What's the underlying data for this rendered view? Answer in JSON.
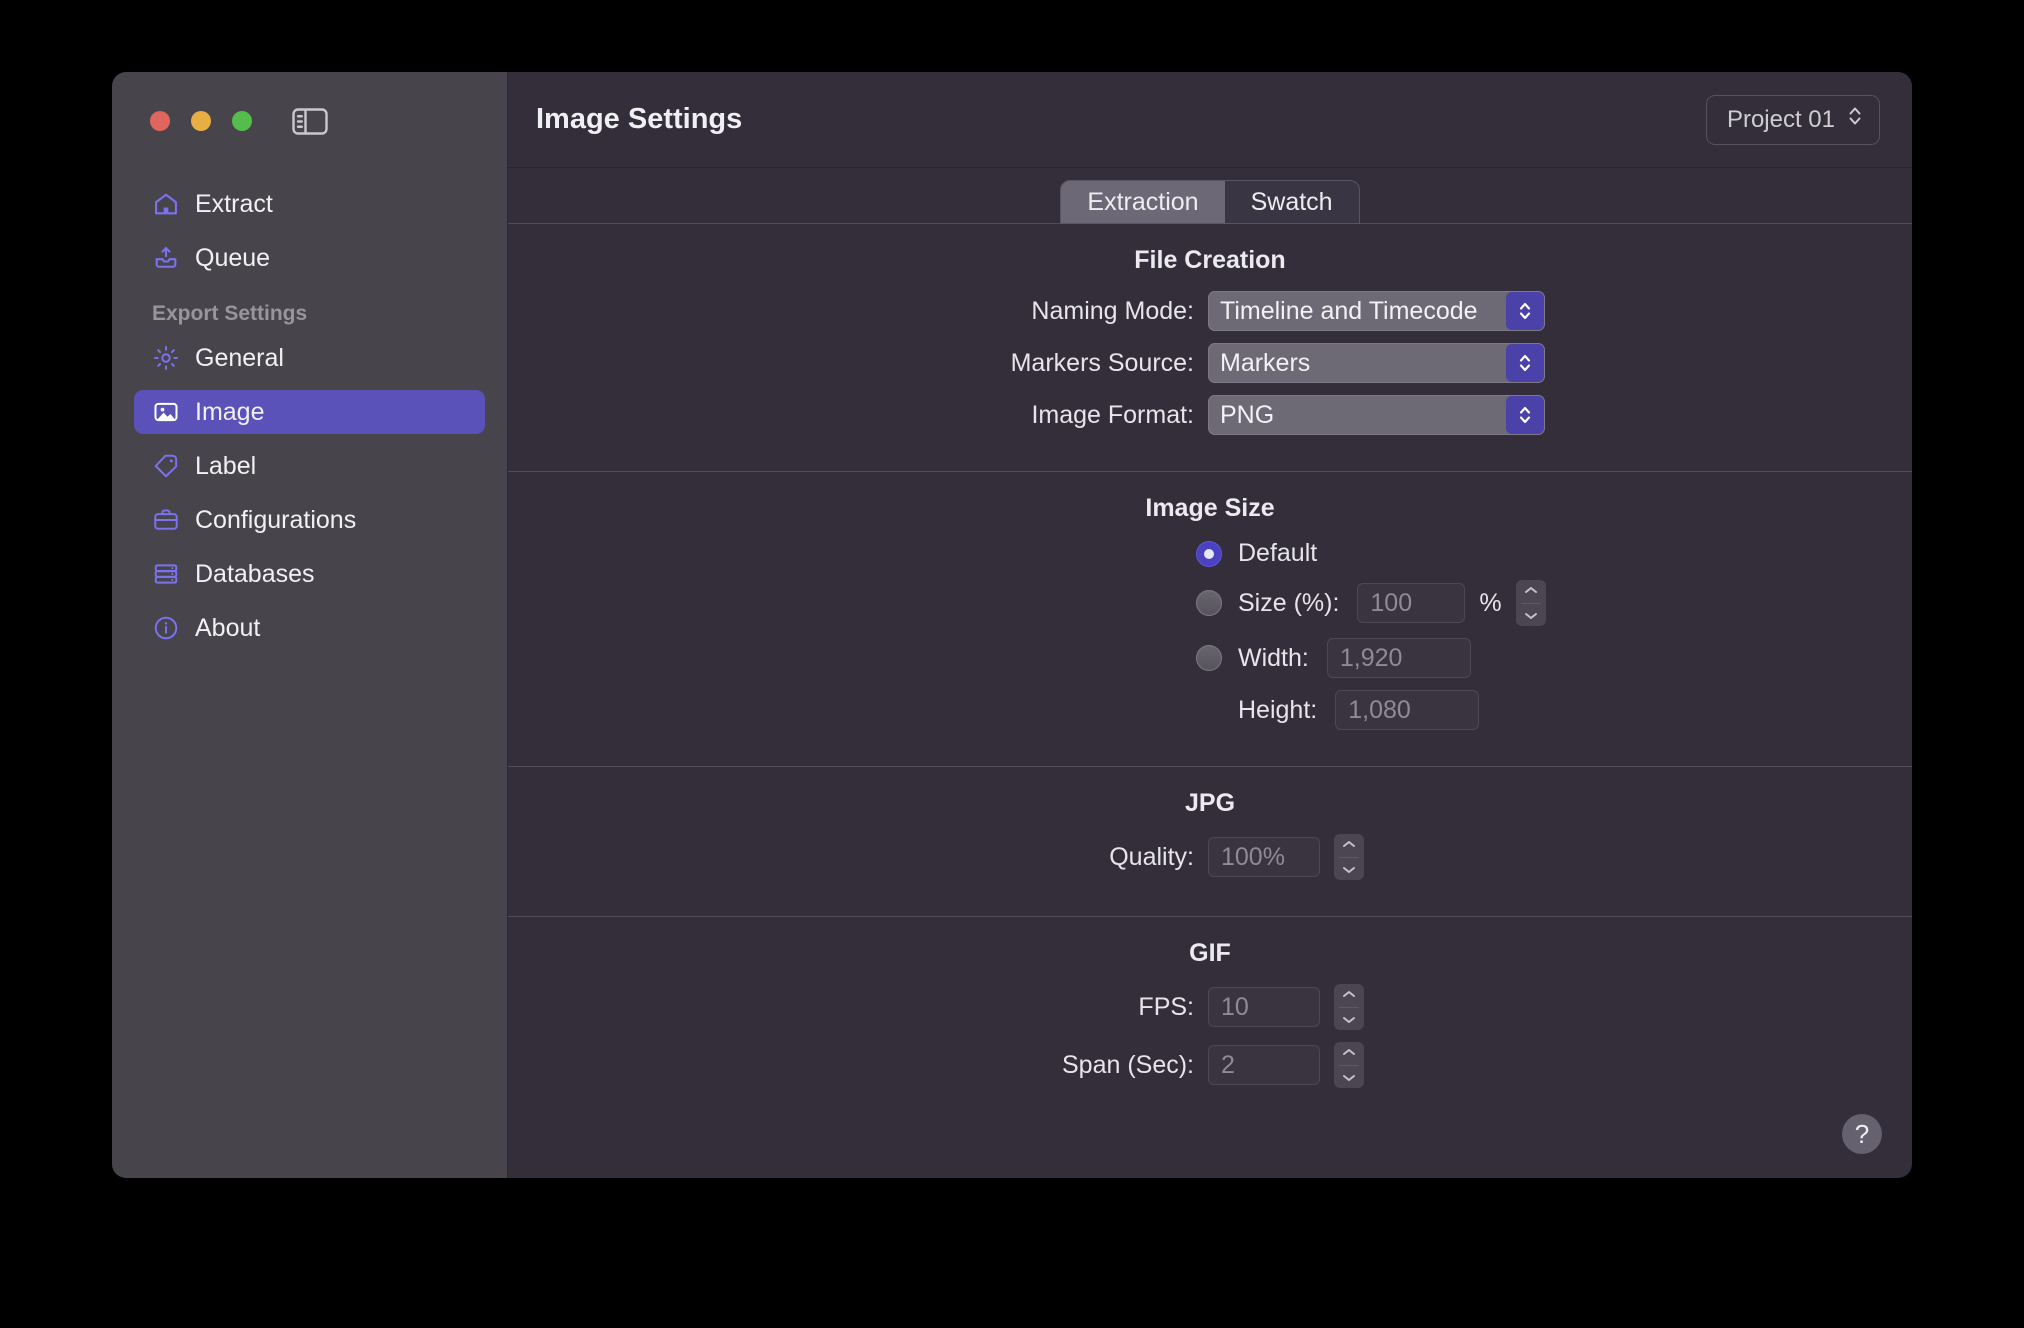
{
  "window": {
    "traffic_lights": [
      "close",
      "minimize",
      "zoom"
    ],
    "sidebar_toggle_icon": "sidebar-toggle-icon"
  },
  "sidebar": {
    "top_items": [
      {
        "label": "Extract",
        "icon": "house-icon"
      },
      {
        "label": "Queue",
        "icon": "tray-upload-icon"
      }
    ],
    "group_label": "Export Settings",
    "settings_items": [
      {
        "label": "General",
        "icon": "gear-icon"
      },
      {
        "label": "Image",
        "icon": "photo-icon"
      },
      {
        "label": "Label",
        "icon": "tag-icon"
      },
      {
        "label": "Configurations",
        "icon": "briefcase-icon"
      },
      {
        "label": "Databases",
        "icon": "database-icon"
      },
      {
        "label": "About",
        "icon": "info-circle-icon"
      }
    ],
    "selected": "Image",
    "accent_color": "#5a52b8",
    "icon_color": "#7b72f0"
  },
  "header": {
    "title": "Image Settings",
    "project_picker": {
      "value": "Project 01",
      "icon": "chevron-updown-icon"
    }
  },
  "tabs": [
    {
      "label": "Extraction",
      "active": true
    },
    {
      "label": "Swatch",
      "active": false
    }
  ],
  "sections": {
    "file_creation": {
      "title": "File Creation",
      "rows": [
        {
          "label": "Naming Mode:",
          "value": "Timeline and Timecode"
        },
        {
          "label": "Markers Source:",
          "value": "Markers"
        },
        {
          "label": "Image Format:",
          "value": "PNG"
        }
      ]
    },
    "image_size": {
      "title": "Image Size",
      "default_label": "Default",
      "size_label": "Size (%):",
      "size_value": "100",
      "percent_symbol": "%",
      "width_label": "Width:",
      "width_value": "1,920",
      "height_label": "Height:",
      "height_value": "1,080"
    },
    "jpg": {
      "title": "JPG",
      "quality_label": "Quality:",
      "quality_value": "100%"
    },
    "gif": {
      "title": "GIF",
      "fps_label": "FPS:",
      "fps_value": "10",
      "span_label": "Span (Sec):",
      "span_value": "2"
    }
  },
  "help": {
    "label": "?"
  }
}
